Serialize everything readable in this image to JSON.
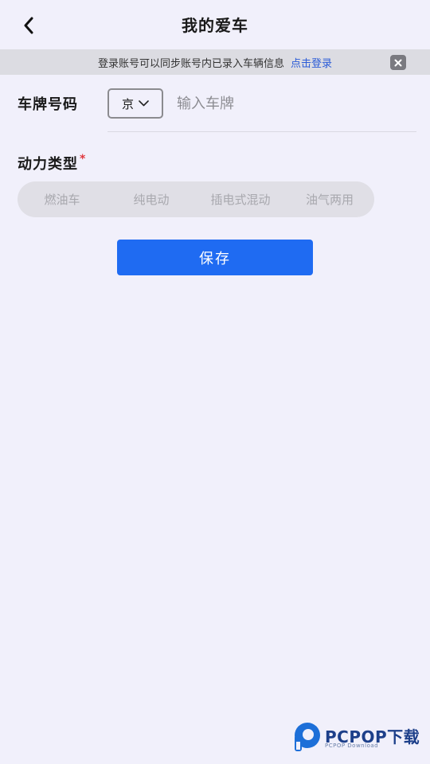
{
  "header": {
    "title": "我的爱车"
  },
  "banner": {
    "message": "登录账号可以同步账号内已录入车辆信息",
    "login_link": "点击登录"
  },
  "plate": {
    "label": "车牌号码",
    "province": "京",
    "placeholder": "输入车牌",
    "value": ""
  },
  "power_type": {
    "label": "动力类型",
    "required_mark": "*",
    "options": [
      "燃油车",
      "纯电动",
      "插电式混动",
      "油气两用"
    ]
  },
  "save_label": "保存",
  "watermark": {
    "brand": "PCPOP下载",
    "sub": "PCPOP Download"
  },
  "colors": {
    "background": "#f1f0fb",
    "primary": "#1f6bf2",
    "link": "#2a5bd7",
    "required": "#e0383e"
  }
}
